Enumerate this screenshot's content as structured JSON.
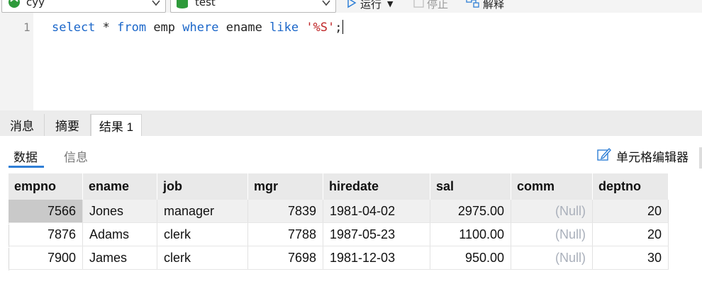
{
  "toolbar": {
    "connection": "cyy",
    "database": "test",
    "run_label": "运行",
    "stop_label": "停止",
    "explain_label": "解释"
  },
  "editor": {
    "line_number": "1",
    "tokens": {
      "select": "select",
      "star": " * ",
      "from": "from",
      "emp": " emp ",
      "where": "where",
      "ename": " ename ",
      "like": "like",
      "space": " ",
      "pattern": "'%S'",
      "semicolon": ";"
    }
  },
  "result_tabs": [
    "消息",
    "摘要",
    "结果 1"
  ],
  "sub_tabs": {
    "data": "数据",
    "info": "信息"
  },
  "cell_editor_label": "单元格编辑器",
  "grid": {
    "columns": [
      "empno",
      "ename",
      "job",
      "mgr",
      "hiredate",
      "sal",
      "comm",
      "deptno"
    ],
    "rows": [
      [
        "7566",
        "Jones",
        "manager",
        "7839",
        "1981-04-02",
        "2975.00",
        "(Null)",
        "20"
      ],
      [
        "7876",
        "Adams",
        "clerk",
        "7788",
        "1987-05-23",
        "1100.00",
        "(Null)",
        "20"
      ],
      [
        "7900",
        "James",
        "clerk",
        "7698",
        "1981-12-03",
        "950.00",
        "(Null)",
        "30"
      ]
    ]
  },
  "colors": {
    "keyword": "#1a66c9",
    "string": "#c0282a",
    "accent": "#2f7fd6",
    "null": "#aab0bb"
  }
}
